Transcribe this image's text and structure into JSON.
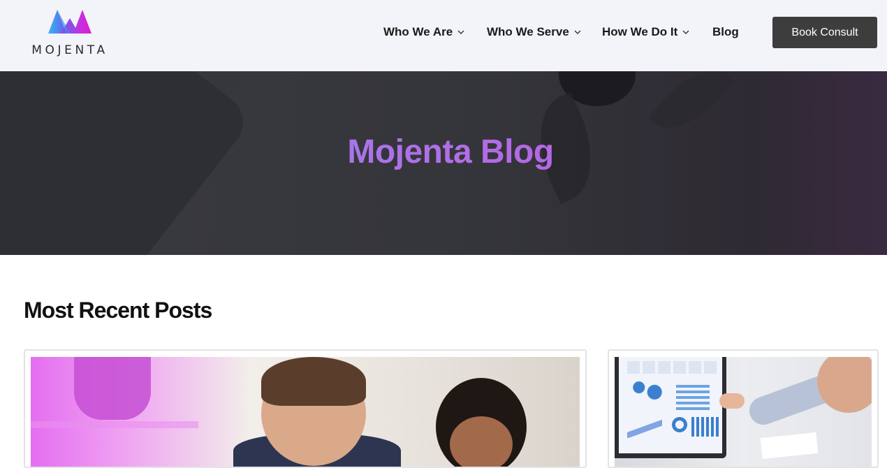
{
  "header": {
    "logo_text": "MOJENTA",
    "nav": [
      {
        "label": "Who We Are",
        "has_dropdown": true
      },
      {
        "label": "Who We Serve",
        "has_dropdown": true
      },
      {
        "label": "How We Do It",
        "has_dropdown": true
      },
      {
        "label": "Blog",
        "has_dropdown": false
      }
    ],
    "cta_label": "Book Consult"
  },
  "hero": {
    "title": "Mojenta Blog"
  },
  "recent_posts": {
    "title": "Most Recent Posts",
    "cards": [
      {
        "image": "two-people-smiling-photo"
      },
      {
        "image": "analytics-dashboard-monitor-photo"
      }
    ]
  },
  "colors": {
    "brand_purple": "#c74de0",
    "brand_blue": "#8a8ef5",
    "cta_bg": "#3d3d3e",
    "header_bg": "#f3f4f9",
    "hero_bg": "#35363a"
  },
  "icons": [
    "mojenta-logo-icon",
    "chevron-down-icon"
  ]
}
